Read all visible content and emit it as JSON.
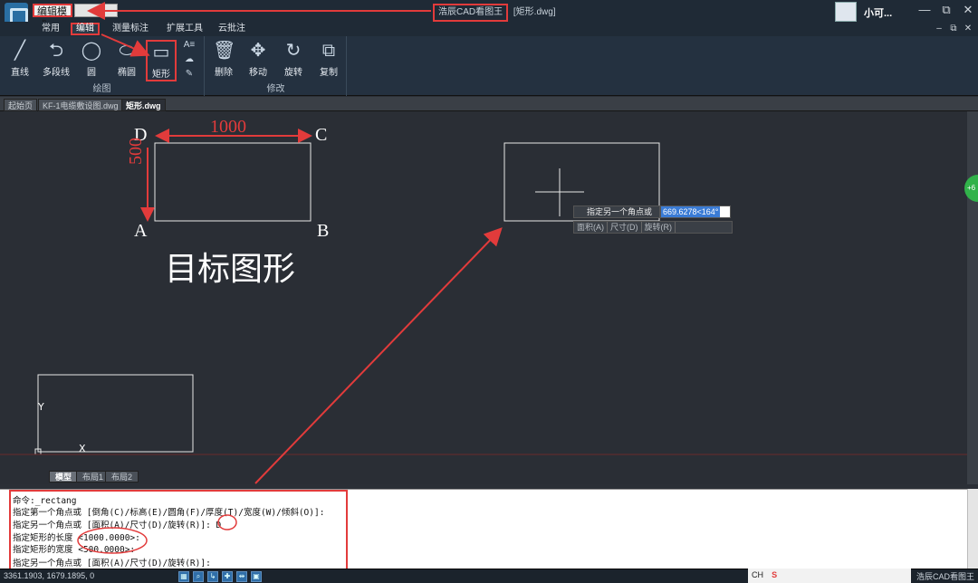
{
  "titlebar": {
    "mode_label": "编辑模式",
    "app_name": "浩辰CAD看图王",
    "doc_name": "[矩形.dwg]",
    "user_name": "小可...",
    "ctrl_minimize": "—",
    "ctrl_restore": "⧉",
    "ctrl_close": "✕",
    "ctrl_small_min": "–",
    "ctrl_small_restore": "⧉",
    "ctrl_small_close": "✕"
  },
  "ribbon": {
    "tabs": [
      "常用",
      "编辑",
      "测量标注",
      "扩展工具",
      "云批注"
    ],
    "draw_panel": {
      "title": "绘图",
      "tools": [
        "直线",
        "多段线",
        "圆",
        "椭圆",
        "矩形"
      ]
    },
    "modify_panel": {
      "title": "修改",
      "tools": [
        "删除",
        "移动",
        "旋转",
        "复制"
      ]
    }
  },
  "doc_tabs": [
    "起始页",
    "KF-1电缆敷设图.dwg",
    "矩形.dwg"
  ],
  "drawing": {
    "label_d": "D",
    "label_c": "C",
    "label_a": "A",
    "label_b": "B",
    "dim_length": "1000",
    "dim_width": "500",
    "target_caption": "目标图形",
    "ucs_y": "Y",
    "ucs_x": "X"
  },
  "prompt": {
    "text": "指定另一个角点或",
    "input_value": "669.6278<164°",
    "options": [
      "面积(A)",
      "尺寸(D)",
      "旋转(R)"
    ]
  },
  "layout_tabs": [
    "模型",
    "布局1",
    "布局2"
  ],
  "command_lines": [
    "命令:_rectang",
    "指定第一个角点或 [倒角(C)/标高(E)/圆角(F)/厚度(T)/宽度(W)/倾斜(O)]:",
    "指定另一个角点或 [面积(A)/尺寸(D)/旋转(R)]: D",
    "指定矩形的长度 <1000.0000>:",
    "指定矩形的宽度 <500.0000>:",
    "指定另一个角点或 [面积(A)/尺寸(D)/旋转(R)]:"
  ],
  "status": {
    "coords": "3361.1903, 1679.1895, 0",
    "tray_items": [
      "CH",
      "S"
    ],
    "app_name": "浩辰CAD看图王"
  },
  "side_badge": "+6",
  "colors": {
    "annotation_red": "#e23b3b",
    "canvas_bg": "#2a2e35",
    "accent_blue": "#3a7bd5"
  }
}
